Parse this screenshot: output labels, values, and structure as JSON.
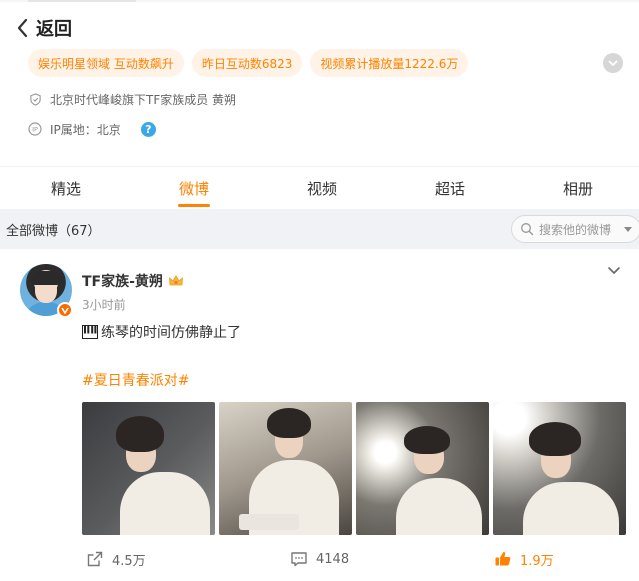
{
  "header": {
    "back_label": "返回",
    "tags": [
      "娱乐明星领域 互动数飙升",
      "昨日互动数6823",
      "视频累计播放量1222.6万"
    ],
    "verification": "北京时代峰峻旗下TF家族成员 黄朔",
    "ip_location": "IP属地：北京",
    "help_mark": "?"
  },
  "tabs": [
    "精选",
    "微博",
    "视频",
    "超话",
    "相册"
  ],
  "active_tab": "微博",
  "filter": {
    "count_label": "全部微博（67）",
    "search_placeholder": "搜索他的微博"
  },
  "post": {
    "username": "TF家族-黄朔",
    "time": "3小时前",
    "text": "练琴的时间仿佛静止了",
    "hashtag": "#夏日青春派对#",
    "photo_count": 4,
    "reposts": "4.5万",
    "comments": "4148",
    "likes": "1.9万"
  },
  "colors": {
    "accent": "#ff8200",
    "tag_bg": "#fff2e6",
    "help_blue": "#3aa8e8"
  }
}
